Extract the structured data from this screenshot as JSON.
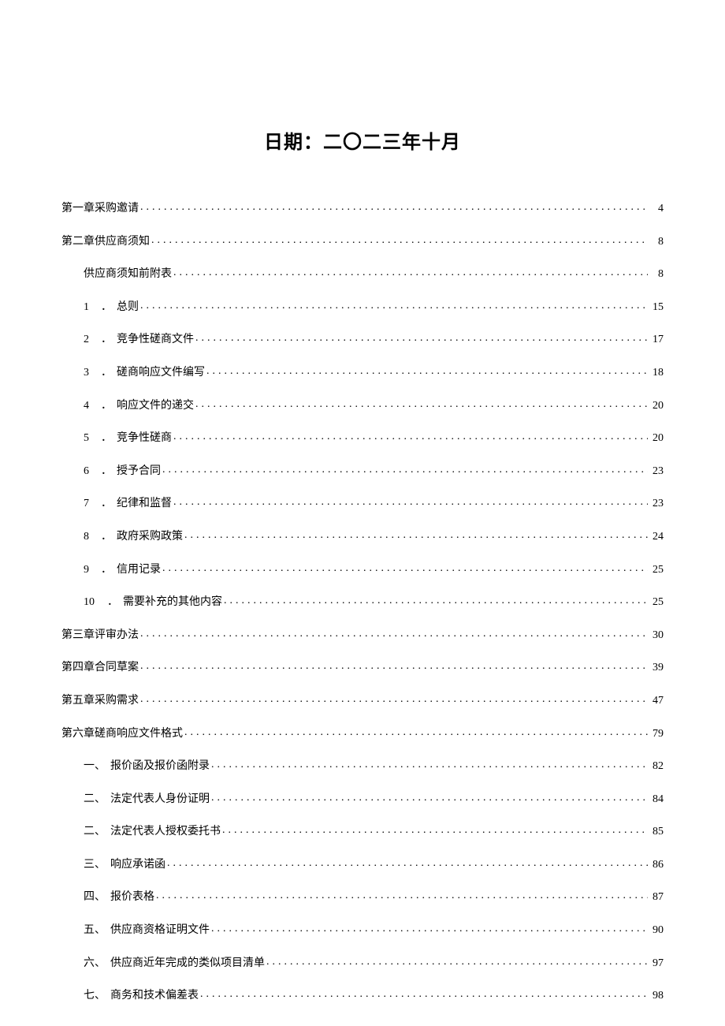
{
  "title": "日期：二〇二三年十月",
  "toc": [
    {
      "level": 1,
      "num": "",
      "prefix": "",
      "label": "第一章采购邀请",
      "page": "4"
    },
    {
      "level": 1,
      "num": "",
      "prefix": "",
      "label": "第二章供应商须知",
      "page": "8"
    },
    {
      "level": 2,
      "num": "",
      "prefix": "",
      "label": "供应商须知前附表",
      "page": "8"
    },
    {
      "level": 2,
      "num": "1",
      "prefix": "．",
      "label": "总则",
      "page": "15"
    },
    {
      "level": 2,
      "num": "2",
      "prefix": "．",
      "label": "竞争性磋商文件",
      "page": "17"
    },
    {
      "level": 2,
      "num": "3",
      "prefix": "．",
      "label": "磋商响应文件编写",
      "page": "18"
    },
    {
      "level": 2,
      "num": "4",
      "prefix": "．",
      "label": "响应文件的递交",
      "page": "20"
    },
    {
      "level": 2,
      "num": "5",
      "prefix": "．",
      "label": "竞争性磋商",
      "page": "20"
    },
    {
      "level": 2,
      "num": "6",
      "prefix": "．",
      "label": "授予合同",
      "page": "23"
    },
    {
      "level": 2,
      "num": "7",
      "prefix": "．",
      "label": "纪律和监督",
      "page": "23"
    },
    {
      "level": 2,
      "num": "8",
      "prefix": "．",
      "label": "政府采购政策",
      "page": "24"
    },
    {
      "level": 2,
      "num": "9",
      "prefix": "．",
      "label": "信用记录",
      "page": "25"
    },
    {
      "level": 2,
      "num": "10",
      "prefix": "．",
      "label": "需要补充的其他内容",
      "page": "25"
    },
    {
      "level": 1,
      "num": "",
      "prefix": "",
      "label": "第三章评审办法",
      "page": "30"
    },
    {
      "level": 1,
      "num": "",
      "prefix": "",
      "label": "第四章合同草案",
      "page": "39"
    },
    {
      "level": 1,
      "num": "",
      "prefix": "",
      "label": "第五章采购需求",
      "page": "47"
    },
    {
      "level": 1,
      "num": "",
      "prefix": "",
      "label": "第六章磋商响应文件格式",
      "page": "79"
    },
    {
      "level": 2,
      "num": "",
      "prefix": "一、",
      "label": "报价函及报价函附录",
      "page": "82"
    },
    {
      "level": 2,
      "num": "",
      "prefix": "二、",
      "label": "法定代表人身份证明",
      "page": "84"
    },
    {
      "level": 2,
      "num": "",
      "prefix": "二、",
      "label": "法定代表人授权委托书",
      "page": "85"
    },
    {
      "level": 2,
      "num": "",
      "prefix": "三、",
      "label": "响应承诺函",
      "page": "86"
    },
    {
      "level": 2,
      "num": "",
      "prefix": "四、",
      "label": "报价表格",
      "page": "87"
    },
    {
      "level": 2,
      "num": "",
      "prefix": "五、",
      "label": "供应商资格证明文件",
      "page": "90"
    },
    {
      "level": 2,
      "num": "",
      "prefix": "六、",
      "label": "供应商近年完成的类似项目清单",
      "page": "97"
    },
    {
      "level": 2,
      "num": "",
      "prefix": "七、",
      "label": "商务和技术偏差表",
      "page": "98"
    }
  ]
}
